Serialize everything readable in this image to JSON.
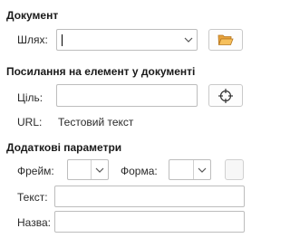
{
  "document_section": {
    "title": "Документ",
    "path_label": "Шлях:",
    "path_value": "",
    "browse_icon": "folder-open-icon"
  },
  "target_section": {
    "title": "Посилання на елемент у документі",
    "target_label": "Ціль:",
    "target_value": "",
    "target_icon": "crosshair-icon",
    "url_label": "URL:",
    "url_value": "Тестовий текст"
  },
  "extra_section": {
    "title": "Додаткові параметри",
    "frame_label": "Фрейм:",
    "frame_value": "",
    "form_label": "Форма:",
    "form_value": "",
    "text_label": "Текст:",
    "text_value": "",
    "name_label": "Назва:",
    "name_value": ""
  }
}
